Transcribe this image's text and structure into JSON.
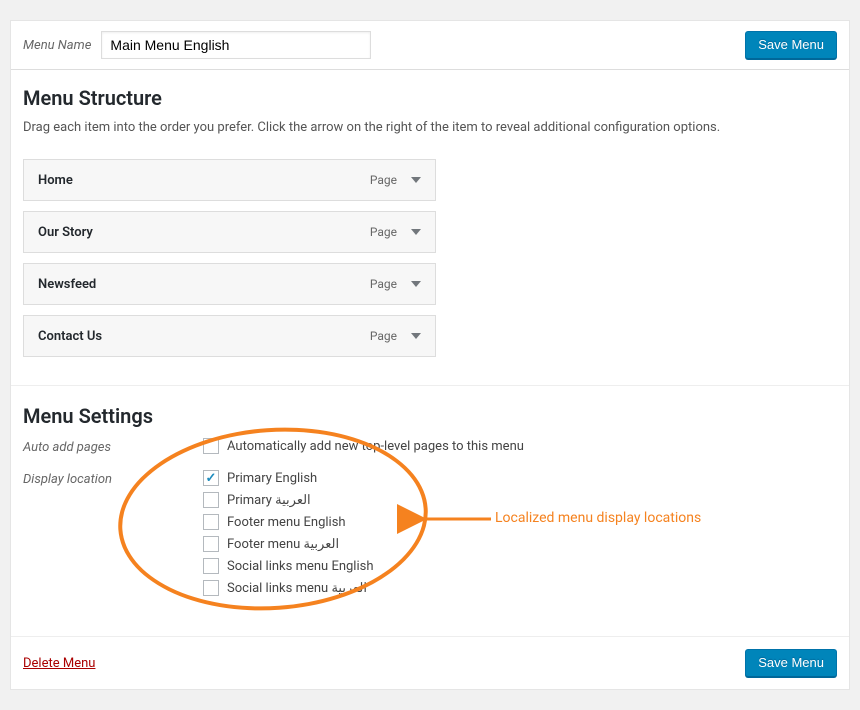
{
  "top": {
    "menuNameLabel": "Menu Name",
    "menuNameValue": "Main Menu English",
    "saveBtn": "Save Menu"
  },
  "structure": {
    "title": "Menu Structure",
    "hint": "Drag each item into the order you prefer. Click the arrow on the right of the item to reveal additional configuration options.",
    "items": [
      {
        "title": "Home",
        "type": "Page"
      },
      {
        "title": "Our Story",
        "type": "Page"
      },
      {
        "title": "Newsfeed",
        "type": "Page"
      },
      {
        "title": "Contact Us",
        "type": "Page"
      }
    ]
  },
  "settings": {
    "title": "Menu Settings",
    "autoAddLabel": "Auto add pages",
    "autoAddText": "Automatically add new top-level pages to this menu",
    "displayLabel": "Display location",
    "locations": [
      {
        "label": "Primary English",
        "checked": true
      },
      {
        "label": "Primary العربية",
        "checked": false
      },
      {
        "label": "Footer menu English",
        "checked": false
      },
      {
        "label": "Footer menu العربية",
        "checked": false
      },
      {
        "label": "Social links menu English",
        "checked": false
      },
      {
        "label": "Social links menu العربية",
        "checked": false
      }
    ]
  },
  "footer": {
    "deleteLabel": "Delete Menu",
    "saveBtn": "Save Menu"
  },
  "annotation": {
    "text": "Localized menu display locations"
  }
}
